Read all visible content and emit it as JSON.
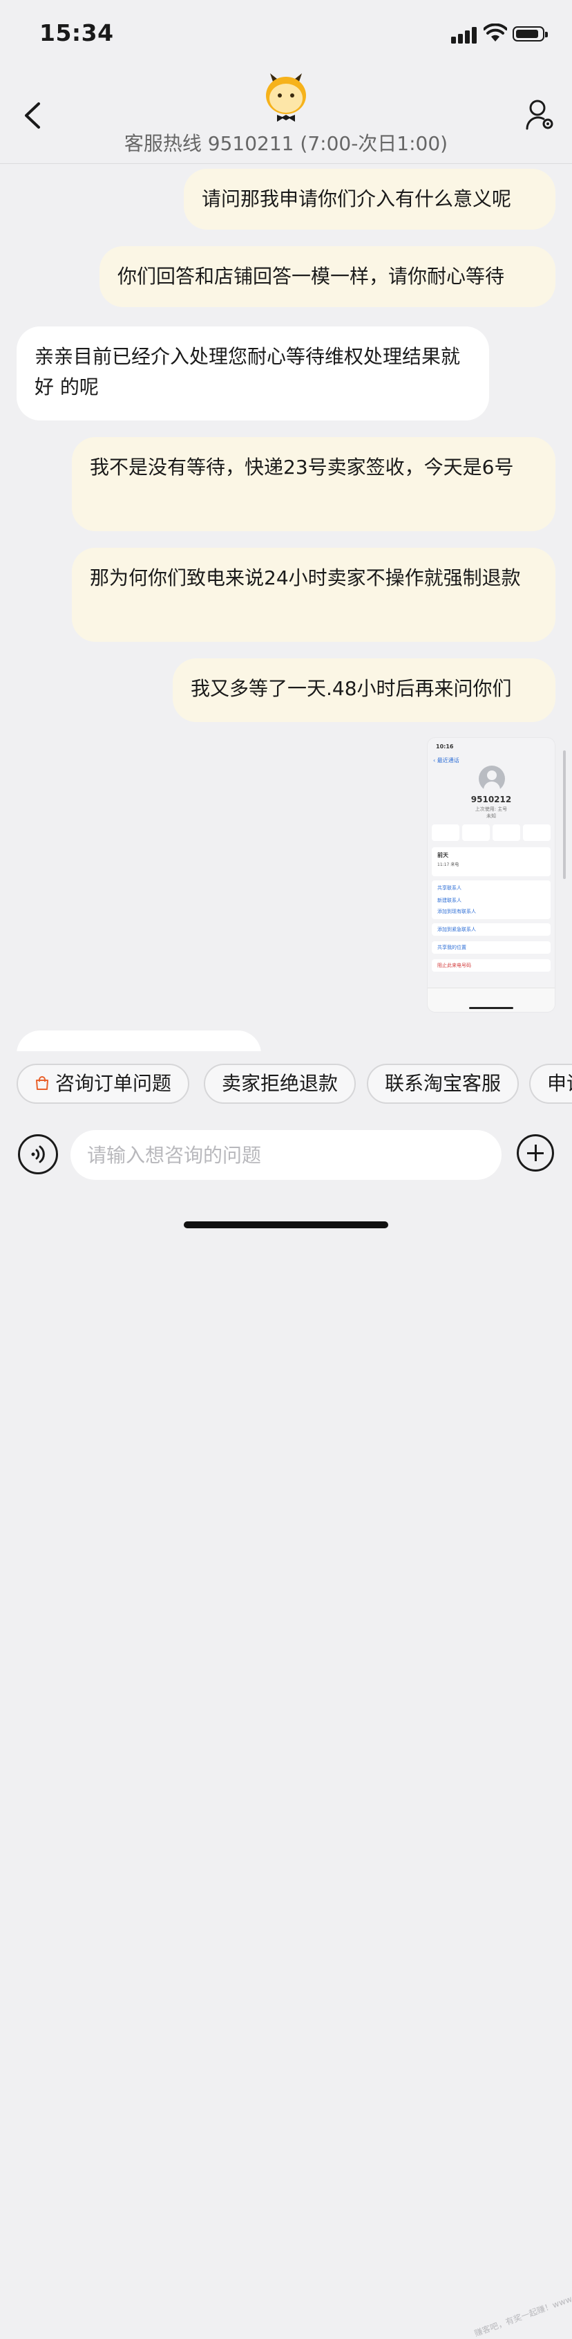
{
  "status_bar": {
    "time": "15:34"
  },
  "header": {
    "hotline": "客服热线 9510211 (7:00-次日1:00)"
  },
  "messages": [
    {
      "side": "out",
      "text": "请问那我申请你们介入有什么意义呢"
    },
    {
      "side": "out",
      "text": "你们回答和店铺回答一模一样，请你耐心等待"
    },
    {
      "side": "in",
      "text": "亲亲目前已经介入处理您耐心等待维权处理结果就好 的呢"
    },
    {
      "side": "out",
      "text": "我不是没有等待，快递23号卖家签收，今天是6号"
    },
    {
      "side": "out",
      "text": "那为何你们致电来说24小时卖家不操作就强制退款"
    },
    {
      "side": "out",
      "text": "我又多等了一天.48小时后再来问你们"
    }
  ],
  "screenshot_thumbnail": {
    "time": "10:16",
    "back_label": "最近通话",
    "number": "9510212",
    "last_used": "上次使用: 主号",
    "unknown": "未知",
    "call_day": "前天",
    "call_detail": "11:17 来电",
    "actions": [
      "共享联系人",
      "新建联系人",
      "添加到现有联系人",
      "添加到紧急联系人",
      "共享我的位置",
      "阻止此来电号码"
    ]
  },
  "quick_replies": [
    "咨询订单问题",
    "卖家拒绝退款",
    "联系淘宝客服",
    "申请"
  ],
  "input": {
    "placeholder": "请输入想咨询的问题",
    "value": ""
  },
  "watermark": "赚客吧，有奖一起赚！www.zuanke8.com",
  "colors": {
    "outgoing_bubble": "#fbf6e5",
    "incoming_bubble": "#ffffff",
    "background": "#f0f0f2"
  }
}
